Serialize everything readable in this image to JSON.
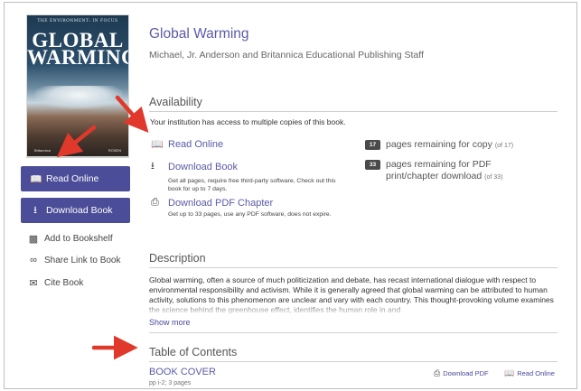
{
  "cover": {
    "top_line": "THE ENVIRONMENT: IN FOCUS",
    "title_line1": "GLOBAL",
    "title_line2": "WARMING",
    "footer_left": "Britannica",
    "footer_right": "ROSEN"
  },
  "sidebar": {
    "read_online_label": "Read Online",
    "download_book_label": "Download Book",
    "add_bookshelf_label": "Add to Bookshelf",
    "share_link_label": "Share Link to Book",
    "cite_label": "Cite Book"
  },
  "book": {
    "title": "Global Warming",
    "authors": "Michael, Jr. Anderson and Britannica Educational Publishing Staff"
  },
  "availability": {
    "heading": "Availability",
    "access_note": "Your institution has access to multiple copies of this book.",
    "read_online_label": "Read Online",
    "download_book_label": "Download Book",
    "download_book_desc": "Get all pages, require free third-party software, Check out this book for up to 7 days.",
    "download_pdf_label": "Download PDF Chapter",
    "download_pdf_desc": "Get up to 33 pages, use any PDF software, does not expire.",
    "copy_badge": "17",
    "copy_text": "pages remaining for copy",
    "copy_of": "(of 17)",
    "pdf_badge": "33",
    "pdf_text_line1": "pages remaining for PDF",
    "pdf_text_line2": "print/chapter download",
    "pdf_of": "(of 33)"
  },
  "description": {
    "heading": "Description",
    "body": "Global warming, often a source of much politicization and debate, has recast international dialogue with respect to environmental responsibility and activism. While it is generally agreed that global warming can be attributed to human activity, solutions to this phenomenon are unclear and vary with each country. This thought-provoking volume examines the science behind the greenhouse effect, identifies the human role in and",
    "show_more": "Show more"
  },
  "toc": {
    "heading": "Table of Contents",
    "item_title": "BOOK COVER",
    "item_pages": "pp i-2; 3 pages",
    "download_pdf": "Download PDF",
    "read_online": "Read Online"
  },
  "annotation": {
    "arrow_color": "#e0392b"
  },
  "icons": {
    "read": "book-open-icon",
    "download": "download-icon",
    "pdf": "printer-icon",
    "bookshelf": "bookshelf-add-icon",
    "share": "link-icon",
    "cite": "quote-bubble-icon"
  }
}
